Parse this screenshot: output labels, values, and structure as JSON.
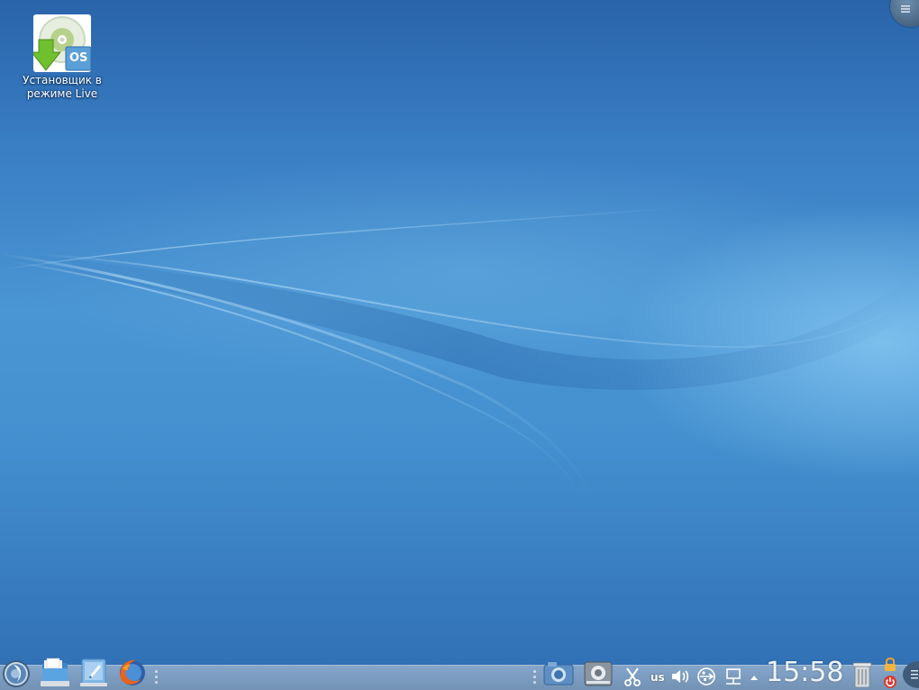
{
  "desktop": {
    "icons": [
      {
        "label_line1": "Установщик в",
        "label_line2": "режиме Live",
        "icon": "live-installer-icon",
        "badge": "OS"
      }
    ]
  },
  "panel": {
    "launchers": [
      {
        "icon": "application-launcher-icon"
      },
      {
        "icon": "file-manager-icon"
      },
      {
        "icon": "text-editor-icon"
      },
      {
        "icon": "firefox-icon"
      }
    ],
    "tray": {
      "keyboard_layout": "us",
      "icons": [
        "screenshot-camera-icon",
        "network-settings-icon",
        "clipboard-scissors-icon",
        "volume-icon",
        "usb-device-icon",
        "network-icon",
        "show-hidden-arrow-icon"
      ]
    },
    "clock": "15:58",
    "trash_icon": "trash-icon",
    "lock_icon": "lock-screen-icon",
    "power_icon": "power-icon"
  },
  "colors": {
    "desktop_top": "#2a64aa",
    "desktop_mid": "#4a95d3",
    "panel": "#a9b6c3",
    "text_light": "#ffffff"
  }
}
